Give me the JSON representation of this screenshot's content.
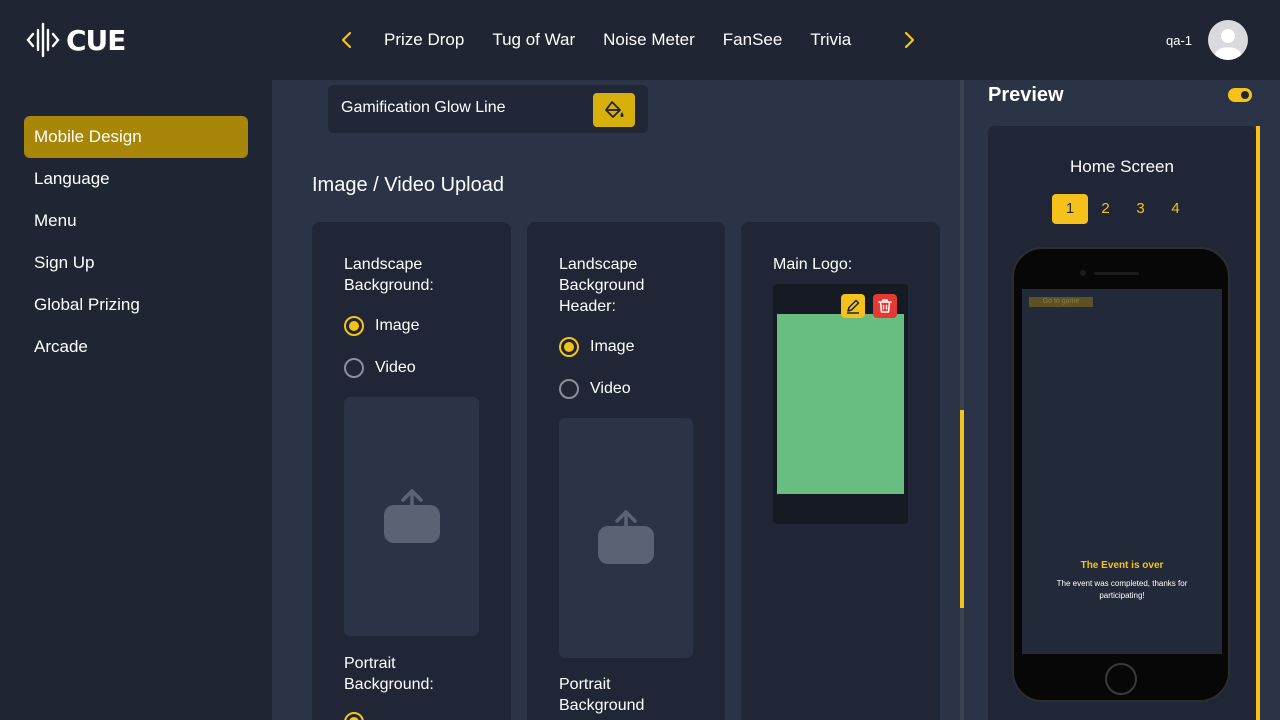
{
  "app": {
    "brand": "CUE",
    "accent": "#f5c21c",
    "active_bg": "#a7860a"
  },
  "header": {
    "tabs": [
      "Prize Drop",
      "Tug of War",
      "Noise Meter",
      "FanSee",
      "Trivia"
    ],
    "prev_icon": "chevron-left-icon",
    "next_icon": "chevron-right-icon",
    "user_name": "qa-1",
    "avatar_icon": "user-avatar-icon"
  },
  "sidebar": {
    "items": [
      {
        "label": "Mobile Design",
        "active": true
      },
      {
        "label": "Language"
      },
      {
        "label": "Menu"
      },
      {
        "label": "Sign Up"
      },
      {
        "label": "Global Prizing"
      },
      {
        "label": "Arcade"
      }
    ]
  },
  "main": {
    "glow_line_label": "Gamification Glow Line",
    "paint_icon": "paint-bucket-icon",
    "section_title": "Image / Video Upload",
    "cards": [
      {
        "label": "Landscape Background:",
        "options": [
          "Image",
          "Video"
        ],
        "selected": "Image",
        "second_label": "Portrait Background:"
      },
      {
        "label": "Landscape Background Header:",
        "options": [
          "Image",
          "Video"
        ],
        "selected": "Image",
        "second_label": "Portrait Background"
      },
      {
        "label": "Main Logo:",
        "edit_icon": "pencil-icon",
        "delete_icon": "trash-icon",
        "image_color": "#68bd80"
      }
    ]
  },
  "preview": {
    "title": "Preview",
    "screen_title": "Home Screen",
    "pages": [
      "1",
      "2",
      "3",
      "4"
    ],
    "active_page": "1",
    "phone": {
      "button_label": "Go to game",
      "event_title": "The Event is over",
      "event_sub": "The event was completed, thanks for participating!"
    }
  }
}
